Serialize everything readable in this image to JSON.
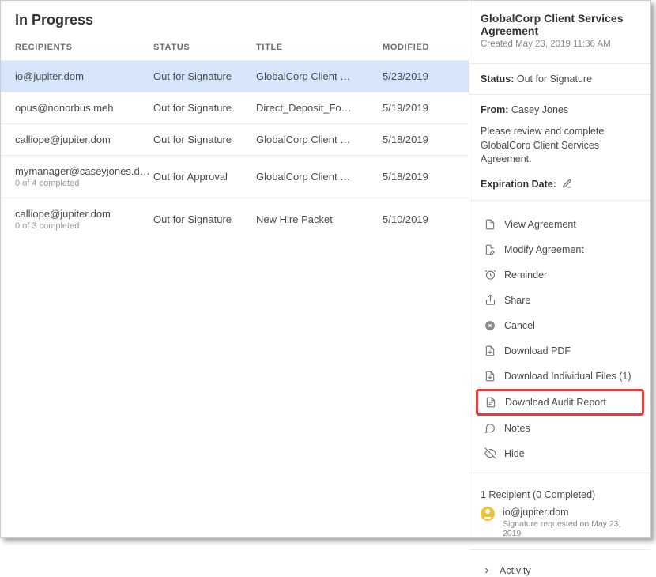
{
  "page_title": "In Progress",
  "columns": {
    "recipients": "RECIPIENTS",
    "status": "STATUS",
    "title": "TITLE",
    "modified": "MODIFIED"
  },
  "rows": [
    {
      "recipient": "io@jupiter.dom",
      "sub": "",
      "status": "Out for Signature",
      "title": "GlobalCorp Client …",
      "date": "5/23/2019",
      "selected": true
    },
    {
      "recipient": "opus@nonorbus.meh",
      "sub": "",
      "status": "Out for Signature",
      "title": "Direct_Deposit_Fo…",
      "date": "5/19/2019",
      "selected": false
    },
    {
      "recipient": "calliope@jupiter.dom",
      "sub": "",
      "status": "Out for Signature",
      "title": "GlobalCorp Client …",
      "date": "5/18/2019",
      "selected": false
    },
    {
      "recipient": "mymanager@caseyjones.d…",
      "sub": "0 of 4 completed",
      "status": "Out for Approval",
      "title": "GlobalCorp Client …",
      "date": "5/18/2019",
      "selected": false
    },
    {
      "recipient": "calliope@jupiter.dom",
      "sub": "0 of 3 completed",
      "status": "Out for Signature",
      "title": "New Hire Packet",
      "date": "5/10/2019",
      "selected": false
    }
  ],
  "detail": {
    "title": "GlobalCorp Client Services Agreement",
    "created": "Created May 23, 2019 11:36 AM",
    "status_label": "Status:",
    "status_value": "Out for Signature",
    "from_label": "From:",
    "from_value": "Casey Jones",
    "message": "Please review and complete GlobalCorp Client Services Agreement.",
    "expiration_label": "Expiration Date:"
  },
  "actions": {
    "view": "View Agreement",
    "modify": "Modify Agreement",
    "reminder": "Reminder",
    "share": "Share",
    "cancel": "Cancel",
    "download_pdf": "Download PDF",
    "download_files": "Download Individual Files (1)",
    "download_audit": "Download Audit Report",
    "notes": "Notes",
    "hide": "Hide"
  },
  "recipients_panel": {
    "heading": "1 Recipient (0 Completed)",
    "name": "io@jupiter.dom",
    "sub": "Signature requested on May 23, 2019"
  },
  "activity_label": "Activity"
}
